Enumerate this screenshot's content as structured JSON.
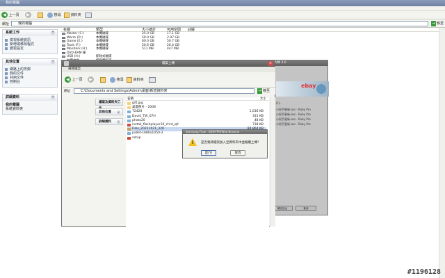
{
  "main_window": {
    "title": "我的電腦",
    "toolbar": {
      "back_label": "上一頁",
      "search_label": "搜尋",
      "folders_label": "資料夾"
    },
    "address": {
      "label": "網址",
      "value": "我的電腦",
      "go_label": "移至"
    },
    "tasks": {
      "system_tasks": {
        "heading": "系統工作",
        "items": [
          "檢視系統資訊",
          "新增或移除程式",
          "變更設定"
        ]
      },
      "other_places": {
        "heading": "其他位置",
        "items": [
          "網路上的芳鄰",
          "我的文件",
          "共用文件",
          "控制台"
        ]
      },
      "details": {
        "heading": "詳細資料",
        "title": "我的電腦",
        "subtitle": "系統資料夾"
      }
    },
    "columns": [
      "名稱",
      "類型",
      "大小總計",
      "可用空間",
      "註解"
    ],
    "drives": [
      {
        "name": "Master (C:)",
        "type": "本機磁碟",
        "total": "25.0 GB",
        "free": "17.1 GB"
      },
      {
        "name": "Warm (D:)",
        "type": "本機磁碟",
        "total": "50.0 GB",
        "free": "2.97 GB"
      },
      {
        "name": "Game (E:)",
        "type": "本機磁碟",
        "total": "60.0 GB",
        "free": "50.7 GB"
      },
      {
        "name": "Tools (F:)",
        "type": "本機磁碟",
        "total": "50.6 GB",
        "free": "26.4 GB"
      },
      {
        "name": "Monitork (H:)",
        "type": "本機磁碟",
        "total": "511 MB",
        "free": "447 MB"
      },
      {
        "name": "DVD-RAM 碟",
        "type": "",
        "total": "",
        "free": ""
      },
      {
        "name": "USB (H:)",
        "type": "卸除式磁碟",
        "total": "",
        "free": ""
      },
      {
        "name": "共用文件",
        "type": "檔案資料夾",
        "total": "",
        "free": ""
      }
    ]
  },
  "ebay_window": {
    "title": "拍賣大師 3.0",
    "logo": "ebay",
    "lines": [
      "(F:)",
      "小幫手更新-ass - Ruby Pro",
      "小幫手更新-ass - Ruby Pro",
      "小幫手更新-ass - Ruby Pro",
      "小幫手更新-ass - Ruby Pro"
    ],
    "buttons": [
      "確定送出",
      "取消"
    ]
  },
  "file_dialog": {
    "title": "檔案上傳",
    "subtitle": "選擇檔案",
    "toolbar": {
      "back_label": "上一頁",
      "search_label": "搜尋",
      "folders_label": "資料夾"
    },
    "address": {
      "label": "網址",
      "value": "C:\\Documents and Settings\\Admin\\桌面\\新增資料夾",
      "go_label": "移至"
    },
    "panels": [
      "檔案及資料夾工作",
      "其他位置",
      "詳細資料"
    ],
    "files_header": {
      "name": "名稱",
      "size": "大小"
    },
    "files": [
      {
        "name": "gift.jpg",
        "size": "",
        "icon": "folder"
      },
      {
        "name": "桌面照片 - 2008",
        "size": "",
        "icon": "folder"
      },
      {
        "name": "72420",
        "size": "1,036 KB",
        "icon": "image"
      },
      {
        "name": "David_TW_07H",
        "size": "331 KB",
        "icon": "image"
      },
      {
        "name": "photo20",
        "size": "48 KB",
        "icon": "image"
      },
      {
        "name": "install_flashplayer10_chrd_qfr",
        "size": "738 KB",
        "icon": "app"
      },
      {
        "name": "Files_20211021_328",
        "size": "84,864 KB",
        "icon": "zip"
      },
      {
        "name": "pallet-1680x1050-3",
        "size": "",
        "icon": "image"
      },
      {
        "name": "setup",
        "size": "",
        "icon": "app"
      }
    ]
  },
  "alert": {
    "title": "Samsung Flow - IDM/VPN/Web Browser",
    "message": "是否要將檔案加入至資料夾中並繼續上傳?",
    "ok_label": "是(Y)",
    "cancel_label": "取消"
  },
  "watermark": "#1196128"
}
